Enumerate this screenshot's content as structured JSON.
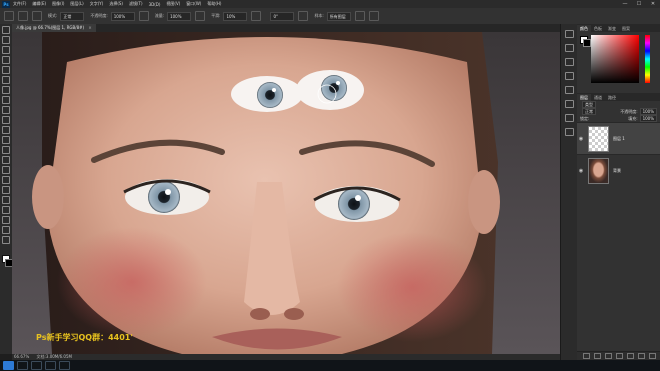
{
  "app": {
    "logo": "Ps"
  },
  "menu": {
    "items": [
      "文件(F)",
      "编辑(E)",
      "图像(I)",
      "图层(L)",
      "文字(Y)",
      "选择(S)",
      "滤镜(T)",
      "3D(D)",
      "视图(V)",
      "窗口(W)",
      "帮助(H)"
    ]
  },
  "window_controls": {
    "minimize": "—",
    "maximize": "☐",
    "close": "✕"
  },
  "options": {
    "mode_label": "模式:",
    "mode_value": "正常",
    "opacity_label": "不透明度:",
    "opacity_value": "100%",
    "flow_label": "流量:",
    "flow_value": "100%",
    "smooth_label": "平滑:",
    "smooth_value": "10%",
    "angle_value": "0°",
    "sample_label": "样本:",
    "sample_value": "所有图层"
  },
  "document_tab": {
    "title": "人像.jpg @ 66.7%(图层 1, RGB/8#)",
    "close": "×"
  },
  "status_bar": {
    "zoom": "66.67%",
    "doc": "文档:3.00M/6.05M"
  },
  "color_panel": {
    "tabs": [
      "颜色",
      "色板",
      "渐变",
      "图案"
    ],
    "foreground": "#ffffff",
    "background": "#000000",
    "hue_color": "#ff0000"
  },
  "layers_panel": {
    "tabs": [
      "图层",
      "通道",
      "路径"
    ],
    "search_placeholder": "类型",
    "blend_mode": "正常",
    "opacity_label": "不透明度:",
    "opacity_value": "100%",
    "lock_label": "锁定:",
    "fill_label": "填充:",
    "fill_value": "100%",
    "layers": [
      {
        "name": "图层 1",
        "visible": true,
        "selected": true
      },
      {
        "name": "背景",
        "visible": true,
        "selected": false
      }
    ]
  },
  "watermark": "Ps新手学习QQ群：4401'",
  "colors": {
    "accent": "#31a8ff",
    "watermark": "#e8c21f",
    "panel_bg": "#323232",
    "app_bg": "#1e1e1e"
  }
}
